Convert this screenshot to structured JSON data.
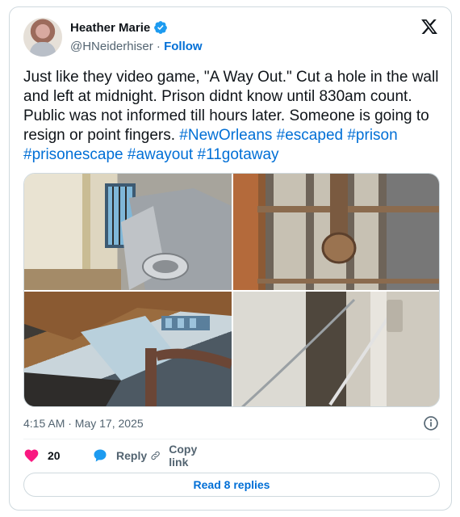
{
  "author": {
    "display_name": "Heather Marie",
    "handle": "@HNeiderhiser",
    "separator": " · ",
    "follow_label": "Follow",
    "verified": true
  },
  "tweet": {
    "text": "Just like they video game, \"A Way Out.\" Cut a hole in the wall and left at midnight. Prison didnt know until 830am count. Public was not informed till hours later. Someone is going to resign or point fingers.",
    "hashtags": [
      "#NewOrleans",
      "#escaped",
      "#prison",
      "#prisonescape",
      "#awayout",
      "#11gotaway"
    ],
    "timestamp": "4:15 AM · May 17, 2025"
  },
  "media": [
    {
      "icon": "photo-jail-cell-toilet"
    },
    {
      "icon": "photo-cell-bars-pipe"
    },
    {
      "icon": "photo-hole-in-wall"
    },
    {
      "icon": "photo-wall-cables"
    }
  ],
  "actions": {
    "like_count": "20",
    "reply_label": "Reply",
    "copy_label": "Copy link"
  },
  "replies_button": "Read 8 replies",
  "colors": {
    "link": "#006fd6",
    "like": "#f91880",
    "reply": "#1d9bf0",
    "verified": "#1d9bf0"
  }
}
